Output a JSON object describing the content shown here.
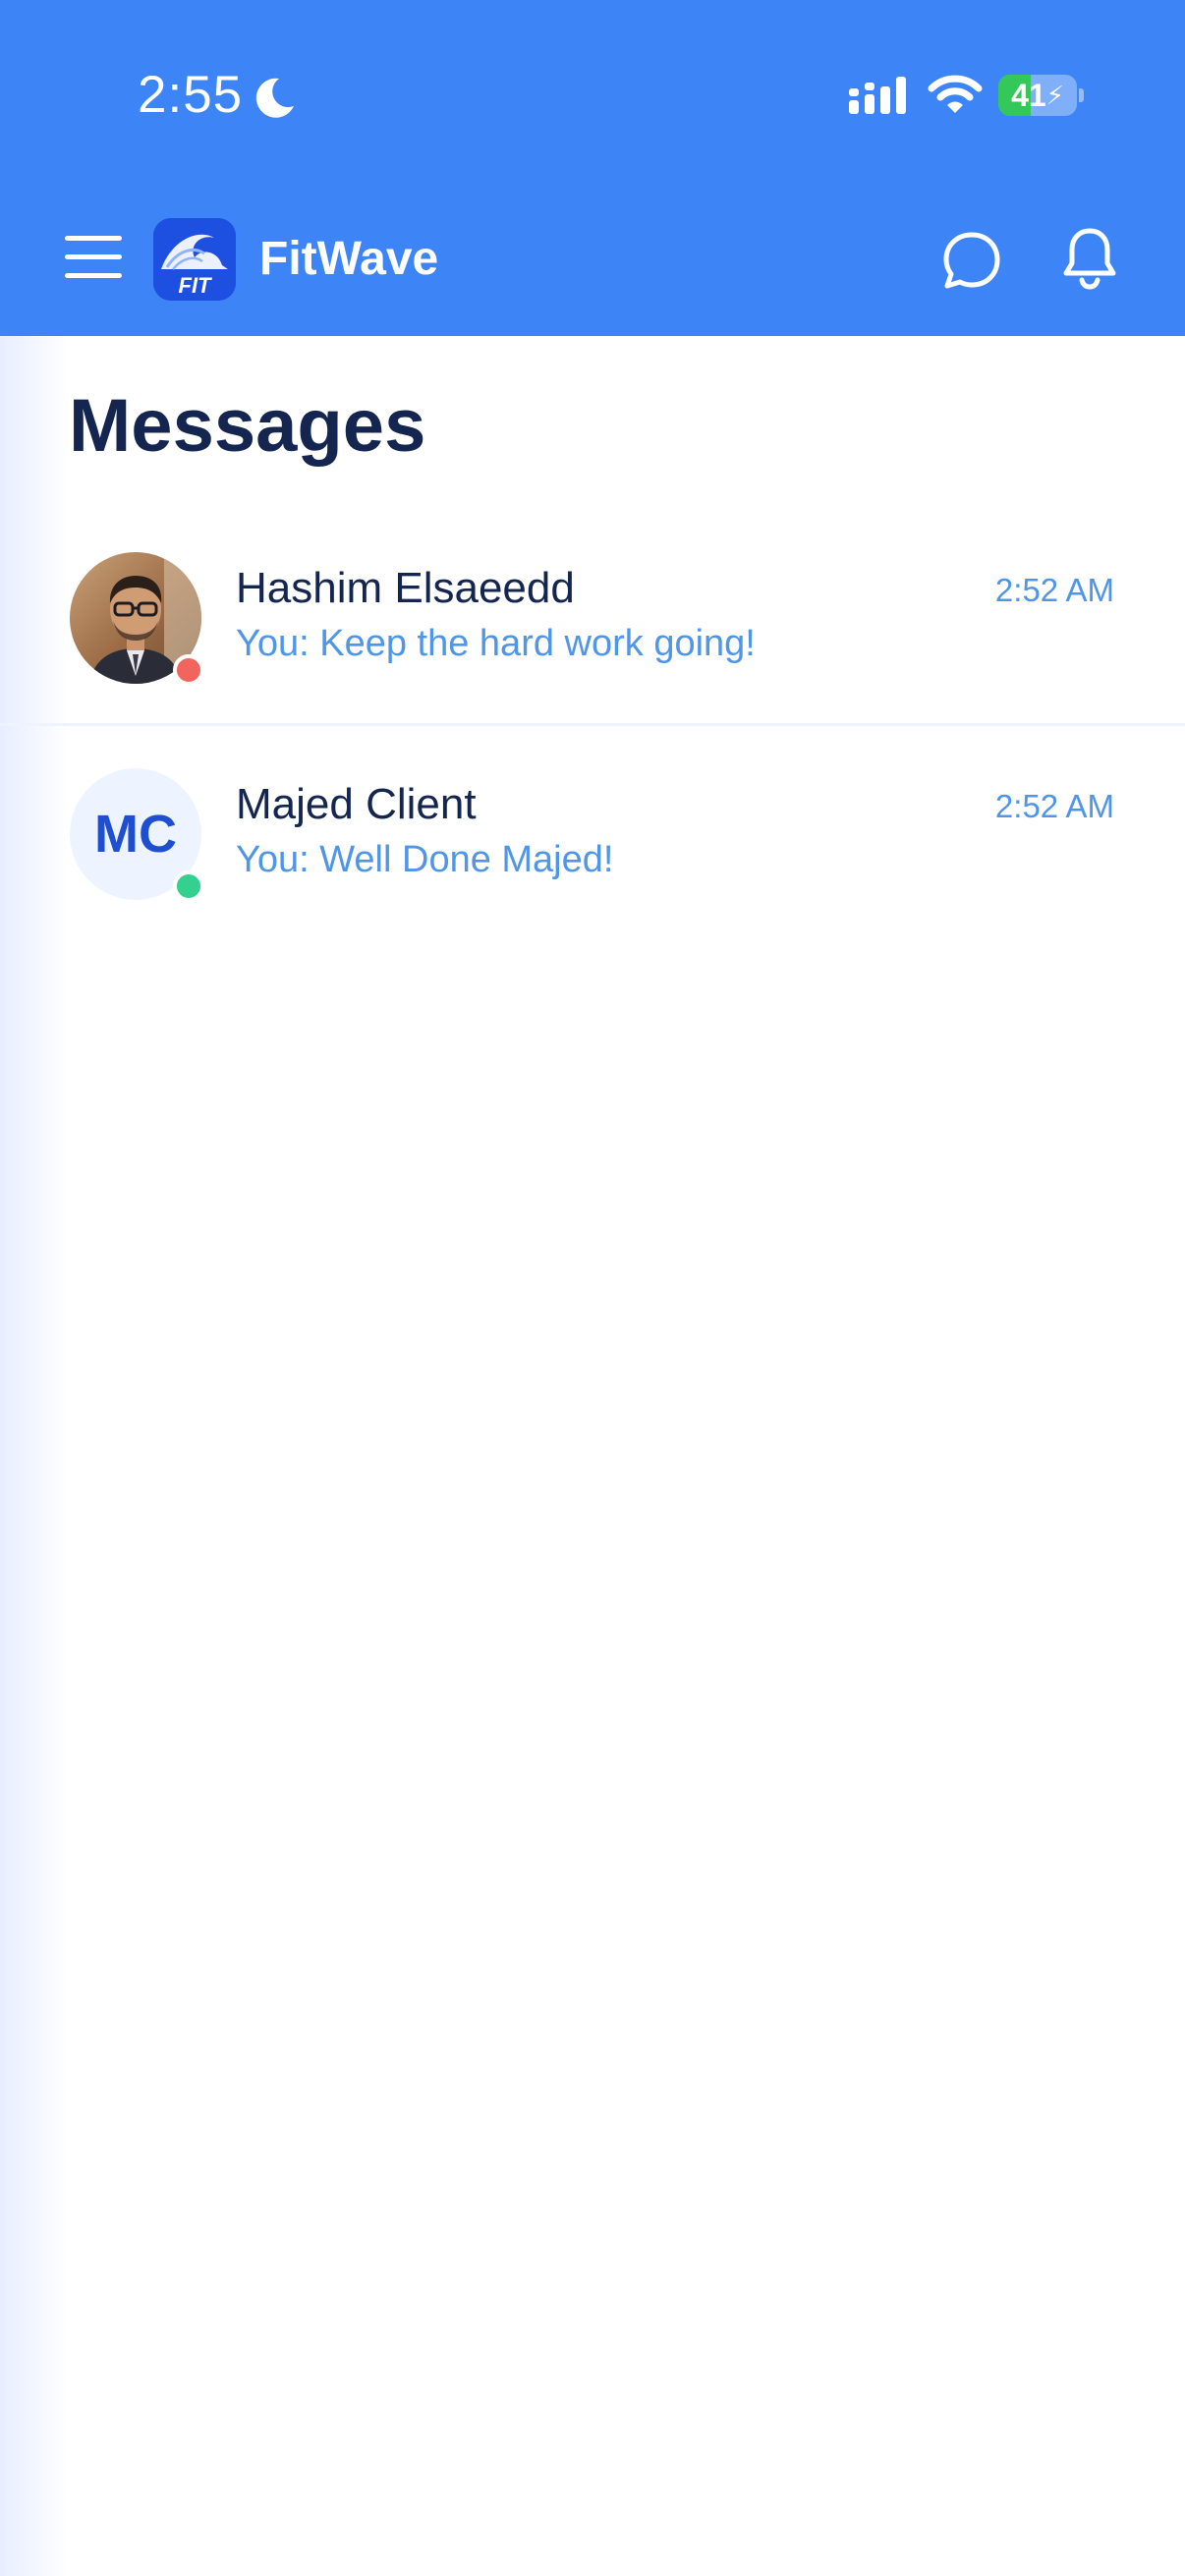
{
  "status_bar": {
    "time": "2:55",
    "battery_level": 41,
    "battery_label": "41",
    "icons": [
      "moon-icon",
      "signal-icon",
      "wifi-icon",
      "battery-icon"
    ]
  },
  "app_bar": {
    "app_name": "FitWave",
    "logo_text": "FIT",
    "icons": [
      "menu-icon",
      "chat-icon",
      "bell-icon"
    ],
    "background_color": "#3d85f6"
  },
  "page": {
    "title": "Messages"
  },
  "conversations": [
    {
      "name": "Hashim Elsaeedd",
      "preview": "You: Keep the hard work going!",
      "time": "2:52 AM",
      "avatar_type": "photo",
      "presence_color": "#f2655f"
    },
    {
      "name": "Majed Client",
      "initials": "MC",
      "preview": "You: Well Done Majed!",
      "time": "2:52 AM",
      "avatar_type": "initials",
      "presence_color": "#34d08f"
    }
  ],
  "colors": {
    "accent": "#3d85f6",
    "title": "#14254f",
    "secondary_text": "#4f95e8"
  }
}
